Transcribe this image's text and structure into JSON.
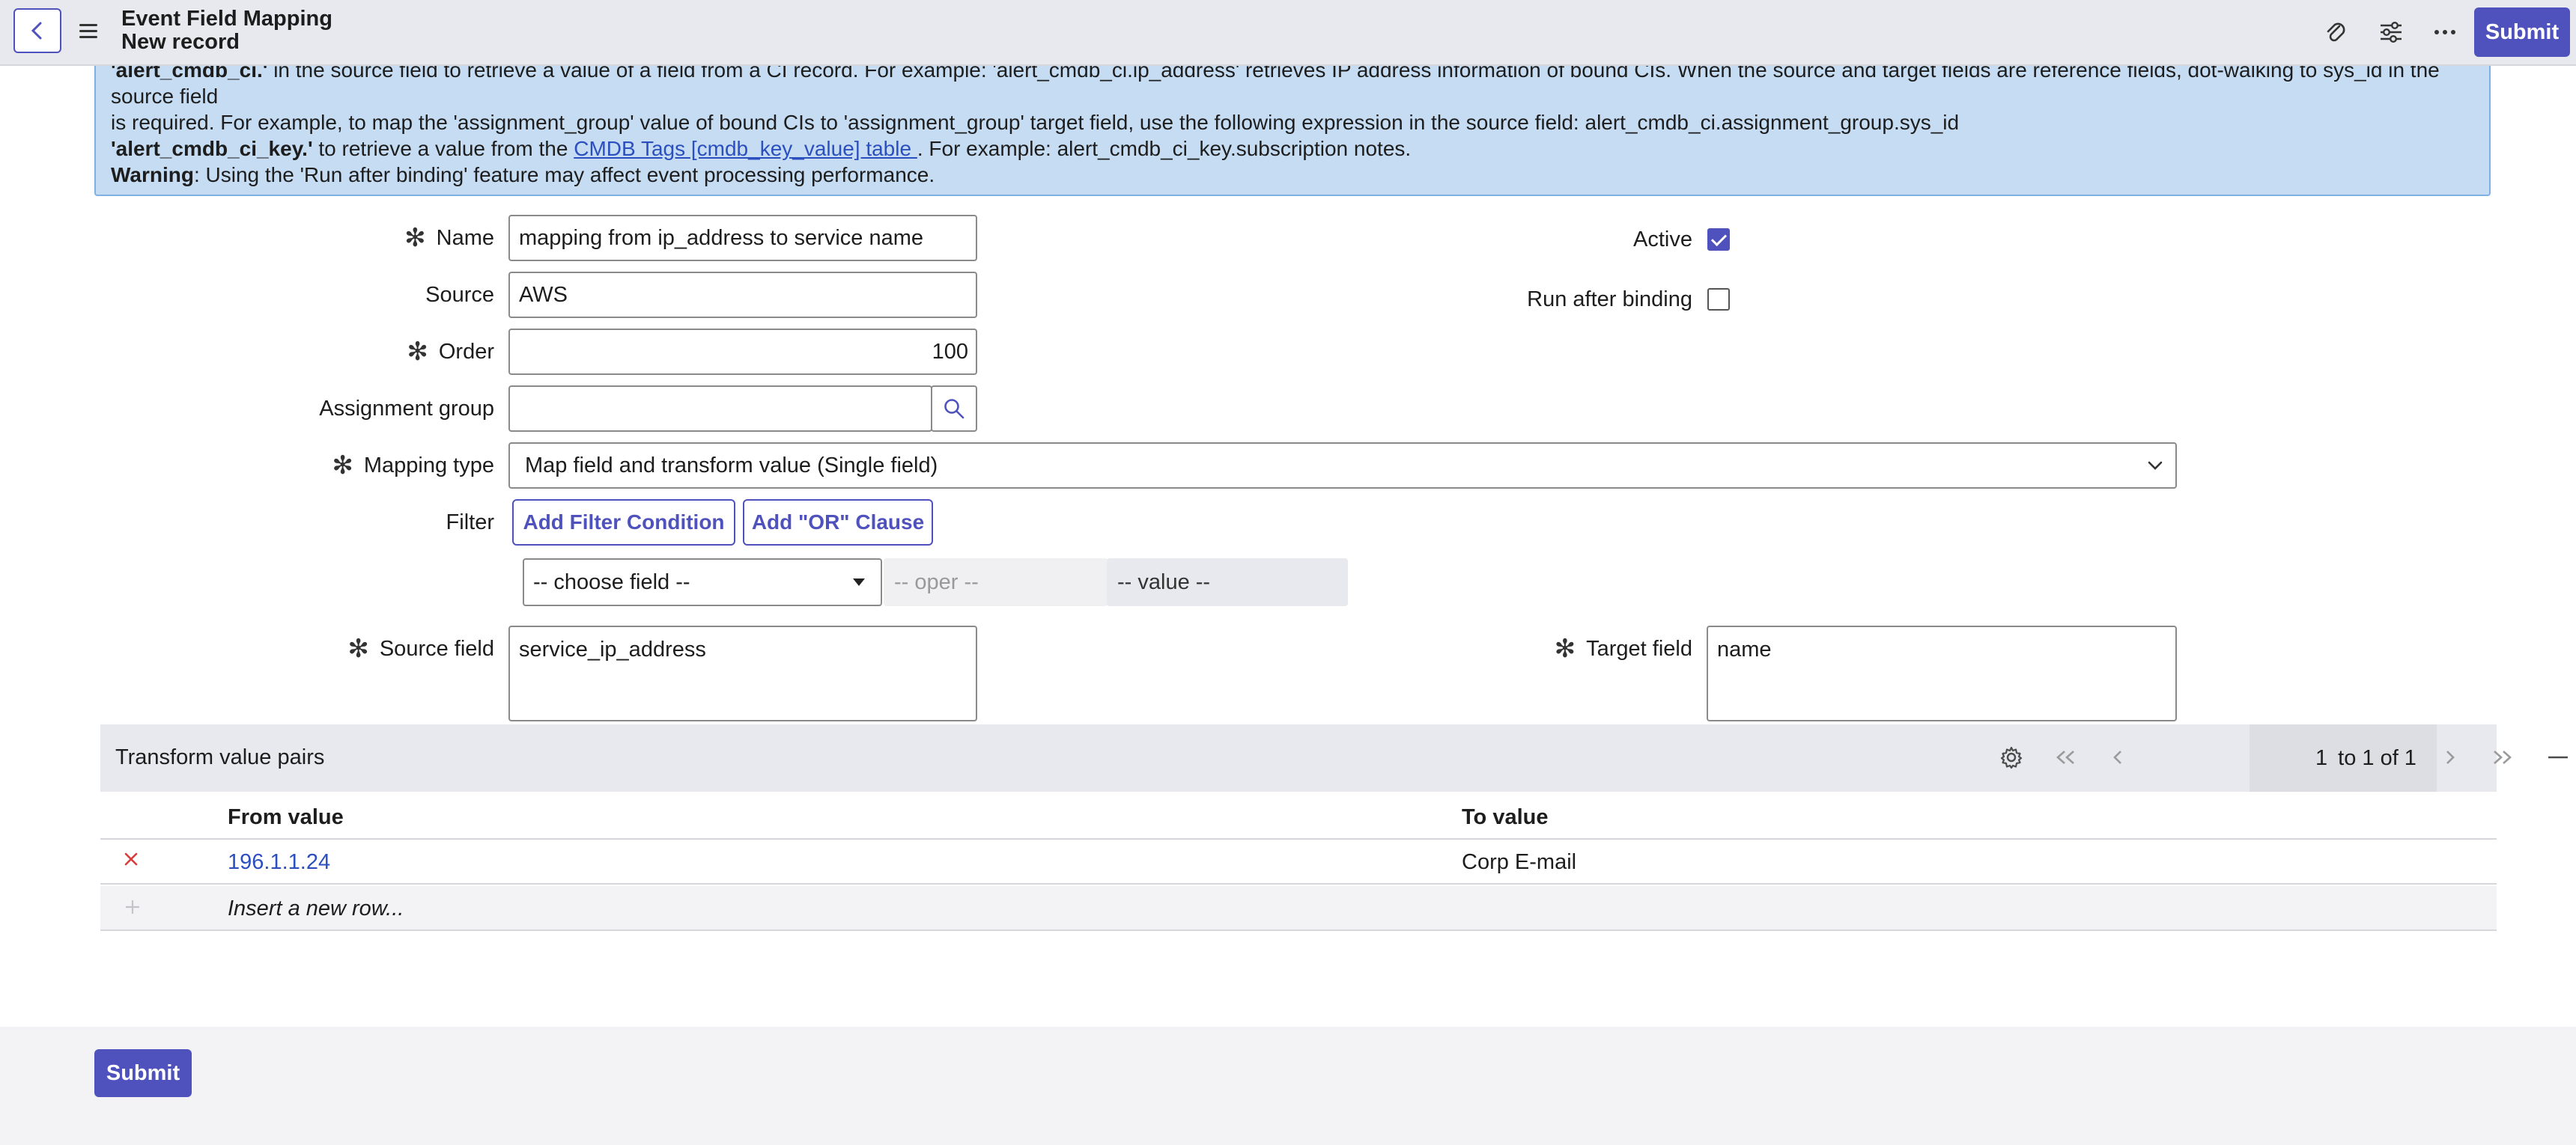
{
  "header": {
    "title": "Event Field Mapping",
    "subtitle": "New record",
    "submit_label": "Submit"
  },
  "info": {
    "line1_bold": "'alert_cmdb_ci.'",
    "line1_rest": " in the source field to retrieve a value of a field from a CI record. For example: 'alert_cmdb_ci.ip_address' retrieves IP address information of bound CIs. When the source and target fields are reference fields, dot-walking to sys_id in the source field",
    "line2": "is required. For example, to map the 'assignment_group' value of bound CIs to 'assignment_group' target field, use the following expression in the source field: alert_cmdb_ci.assignment_group.sys_id",
    "line3_bold": "'alert_cmdb_ci_key.'",
    "line3_mid": " to retrieve a value from the ",
    "line3_link": "CMDB Tags [cmdb_key_value] table ",
    "line3_end": ". For example: alert_cmdb_ci_key.subscription notes.",
    "line4_bold": "Warning",
    "line4_rest": ": Using the 'Run after binding' feature may affect event processing performance."
  },
  "form": {
    "name_label": "Name",
    "name_value": "mapping from ip_address to service name",
    "source_label": "Source",
    "source_value": "AWS",
    "order_label": "Order",
    "order_value": "100",
    "assignment_group_label": "Assignment group",
    "assignment_group_value": "",
    "mapping_type_label": "Mapping type",
    "mapping_type_value": "Map field and transform value (Single field)",
    "filter_label": "Filter",
    "add_filter_label": "Add Filter Condition",
    "add_or_label": "Add \"OR\" Clause",
    "choose_field": "-- choose field --",
    "oper": "-- oper --",
    "value": "-- value --",
    "source_field_label": "Source field",
    "source_field_value": "service_ip_address",
    "active_label": "Active",
    "active_checked": true,
    "run_after_binding_label": "Run after binding",
    "run_after_binding_checked": false,
    "target_field_label": "Target field",
    "target_field_value": "name"
  },
  "related_list": {
    "title": "Transform value pairs",
    "page_current": "1",
    "page_range": "to 1 of 1",
    "columns": [
      "From value",
      "To value"
    ],
    "rows": [
      {
        "from": "196.1.1.24",
        "to": "Corp E-mail"
      }
    ],
    "insert_placeholder": "Insert a new row..."
  },
  "footer": {
    "submit_label": "Submit"
  },
  "colors": {
    "accent": "#4f52bd",
    "banner_bg": "#c5dcf3",
    "link": "#2c4fbf",
    "delete_red": "#d93d3d"
  }
}
